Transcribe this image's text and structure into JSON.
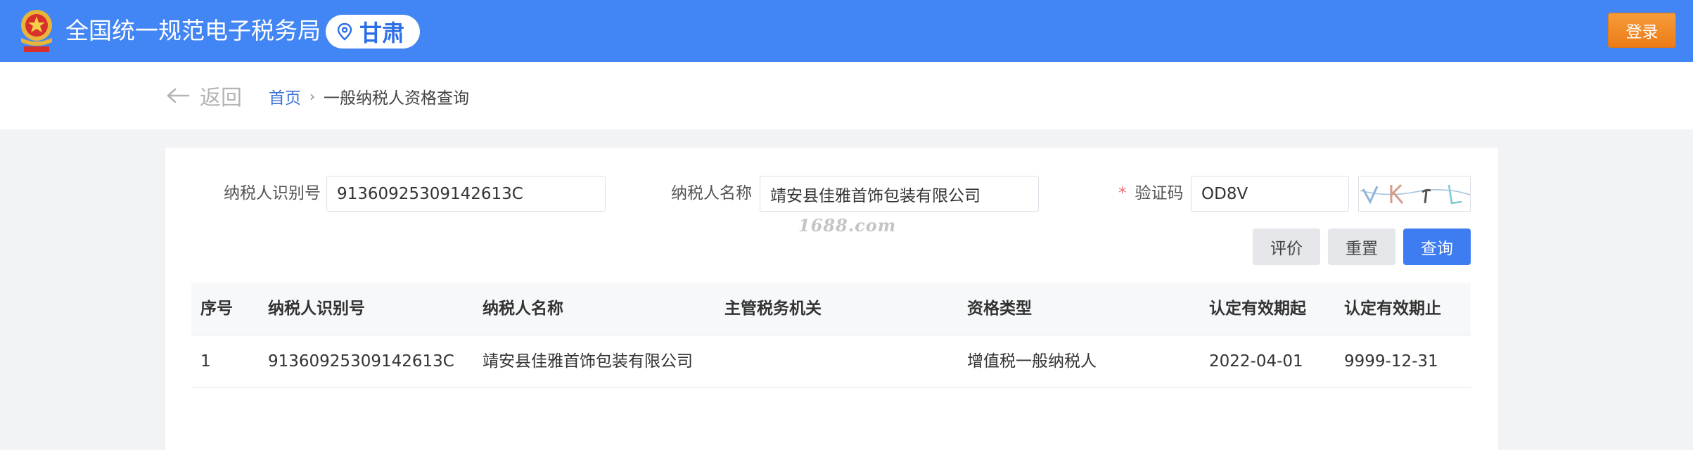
{
  "header": {
    "title": "全国统一规范电子税务局",
    "region": "甘肃",
    "login_label": "登录"
  },
  "nav": {
    "back_label": "返回",
    "breadcrumb_home": "首页",
    "breadcrumb_sep": "›",
    "breadcrumb_current": "一般纳税人资格查询"
  },
  "form": {
    "taxpayer_id_label": "纳税人识别号",
    "taxpayer_id_value": "91360925309142613C",
    "taxpayer_name_label": "纳税人名称",
    "taxpayer_name_value": "靖安县佳雅首饰包装有限公司",
    "captcha_required_mark": "*",
    "captcha_label": "验证码",
    "captcha_value": "OD8V",
    "evaluate_label": "评价",
    "reset_label": "重置",
    "query_label": "查询"
  },
  "watermark": "1688.com",
  "table": {
    "headers": [
      "序号",
      "纳税人识别号",
      "纳税人名称",
      "主管税务机关",
      "资格类型",
      "认定有效期起",
      "认定有效期止"
    ],
    "rows": [
      [
        "1",
        "91360925309142613C",
        "靖安县佳雅首饰包装有限公司",
        "",
        "增值税一般纳税人",
        "2022-04-01",
        "9999-12-31"
      ]
    ]
  },
  "colors": {
    "header_bg": "#4285f4",
    "login_bg": "#ec7c17",
    "primary": "#3d7cf1",
    "link": "#3a72d6",
    "required": "#f56c6c"
  }
}
